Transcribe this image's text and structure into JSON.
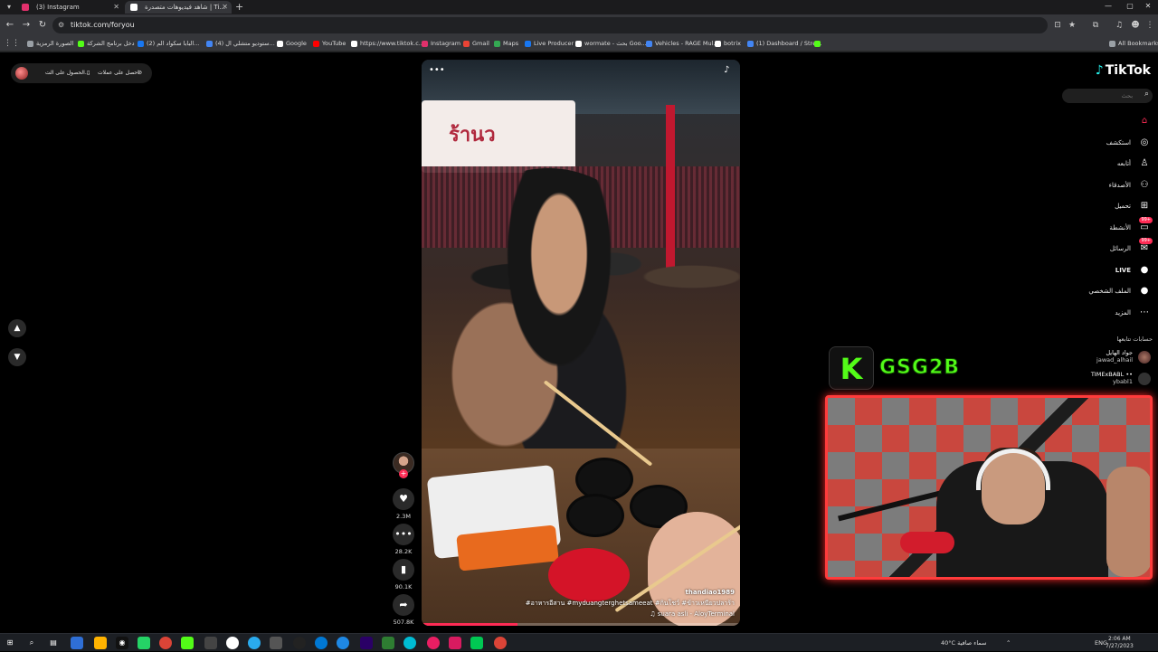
{
  "browser": {
    "tabs": [
      {
        "title": "(3) Instagram",
        "favicon_color": "#e1306c"
      },
      {
        "title": "شاهد فيديوهات متصدرة | Ti...",
        "favicon_color": "#ffffff"
      }
    ],
    "new_tab": "+",
    "url": "tiktok.com/foryou",
    "bookmarks": [
      {
        "label": "الصورة الرمزية",
        "color": "#9aa0a6"
      },
      {
        "label": "دخل برنامج الشركة",
        "color": "#53fc18"
      },
      {
        "label": "(2) البابا سكواد الم...",
        "color": "#1877f2"
      },
      {
        "label": "(4) ستوديو متشلي ال...",
        "color": "#4285f4"
      },
      {
        "label": "Google",
        "color": "#ffffff"
      },
      {
        "label": "YouTube",
        "color": "#ff0000"
      },
      {
        "label": "https://www.tiktok.c...",
        "color": "#ffffff"
      },
      {
        "label": "Instagram",
        "color": "#e1306c"
      },
      {
        "label": "Gmail",
        "color": "#ea4335"
      },
      {
        "label": "Maps",
        "color": "#34a853"
      },
      {
        "label": "Live Producer",
        "color": "#1877f2"
      },
      {
        "label": "wormate - بحث Goo...",
        "color": "#ffffff"
      },
      {
        "label": "Vehicles - RAGE Mul...",
        "color": "#4285f4"
      },
      {
        "label": "botrix",
        "color": "#ffffff"
      },
      {
        "label": "(1) Dashboard / Stre...",
        "color": "#4285f4"
      },
      {
        "label": "",
        "color": "#53fc18"
      }
    ],
    "all_bookmarks": "All Bookmarks"
  },
  "tiktok": {
    "logo": "TikTok",
    "search_placeholder": "بحث",
    "top_pill": {
      "coins": "احصل على عملات",
      "app": "الحصول على الت..."
    },
    "nav": [
      {
        "label": "",
        "icon": "home-icon",
        "glyph": "⌂",
        "active": true
      },
      {
        "label": "استكشف",
        "icon": "compass-icon",
        "glyph": "◎"
      },
      {
        "label": "أتابعه",
        "icon": "following-icon",
        "glyph": "♙"
      },
      {
        "label": "الأصدقاء",
        "icon": "friends-icon",
        "glyph": "⚇"
      },
      {
        "label": "تحميل",
        "icon": "upload-icon",
        "glyph": "⊞"
      },
      {
        "label": "الأنشطة",
        "icon": "activity-icon",
        "glyph": "▭",
        "badge": "99+"
      },
      {
        "label": "الرسائل",
        "icon": "messages-icon",
        "glyph": "✉",
        "badge": "99+"
      },
      {
        "label": "LIVE",
        "icon": "live-icon",
        "glyph": "●"
      },
      {
        "label": "الملف الشخصي",
        "icon": "profile-icon",
        "glyph": "●"
      },
      {
        "label": "المزيد",
        "icon": "more-icon",
        "glyph": "⋯"
      }
    ],
    "following_title": "حسابات تتابعها",
    "following": [
      {
        "name": "جواد الهايل",
        "user": "jawad_alhail"
      },
      {
        "name": "TIMExBABL ••",
        "user": "ybabl1"
      }
    ],
    "video": {
      "sign_text": "ร้านว",
      "creator": "thandiao1989",
      "caption": "#อาหารอีสาน #myduangterghetsameeat #กินโชว์ #ข้าวเหนียวปลาร้า",
      "sound": "♫ suara asli - AloyTerminal",
      "progress": 0.3
    },
    "actions": {
      "likes": "2.3M",
      "comments": "28.2K",
      "saves": "90.1K",
      "shares": "507.8K"
    }
  },
  "overlay": {
    "kick_letter": "K",
    "stream_name": "GSG2B"
  },
  "taskbar": {
    "weather": "40°C  سماء صافية",
    "lang": "ENG",
    "time": "2:06 AM",
    "date": "7/27/2023"
  }
}
